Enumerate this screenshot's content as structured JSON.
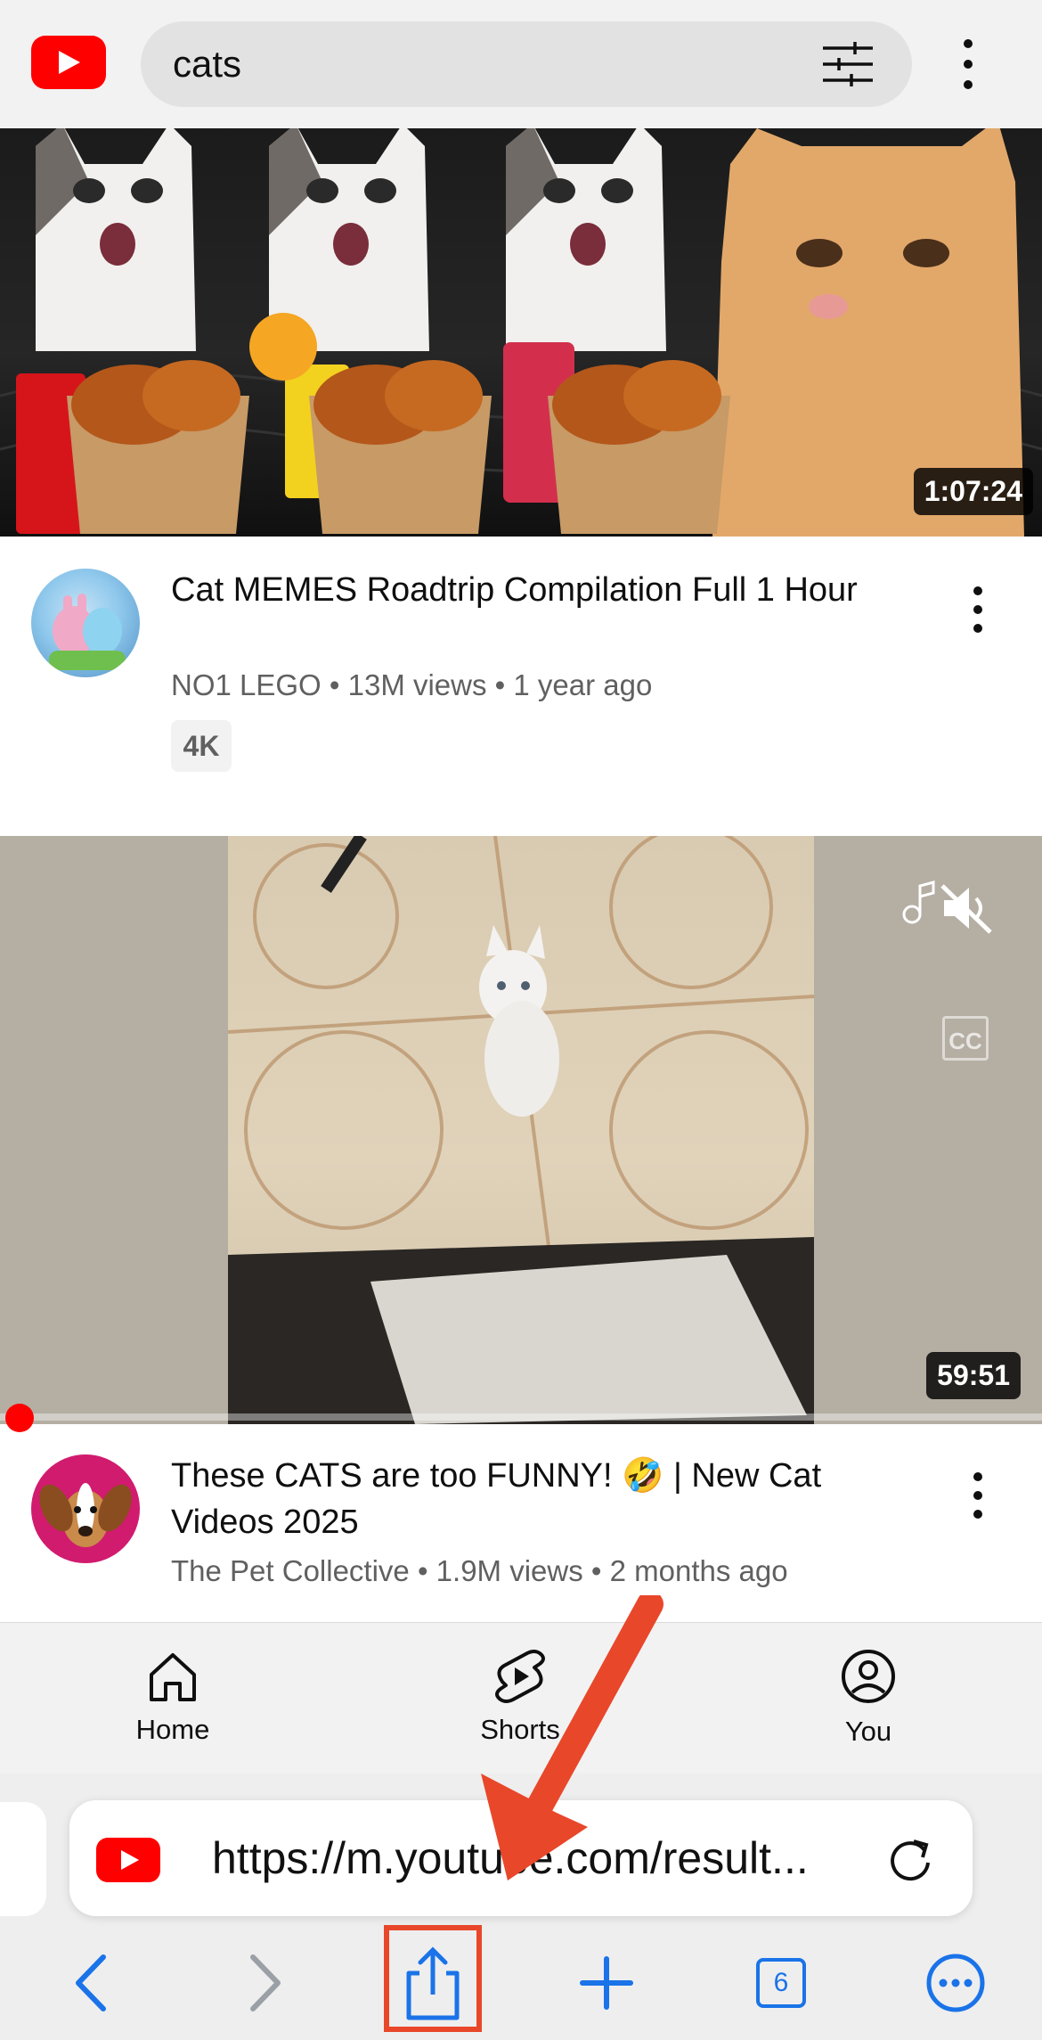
{
  "search": {
    "query": "cats"
  },
  "videos": [
    {
      "title": "Cat MEMES Roadtrip Compilation Full 1 Hour",
      "channel": "NO1 LEGO",
      "meta": "NO1 LEGO • 13M views • 1 year ago",
      "duration": "1:07:24",
      "badge": "4K"
    },
    {
      "title": "These CATS are too FUNNY! 🤣 | New Cat Videos 2025",
      "channel": "The Pet Collective",
      "meta": "The Pet Collective • 1.9M views • 2 months ago",
      "duration": "59:51",
      "captions_label": "CC",
      "playback_progress": 0.01
    }
  ],
  "bottom_nav": [
    {
      "label": "Home",
      "icon": "home-icon"
    },
    {
      "label": "Shorts",
      "icon": "shorts-icon"
    },
    {
      "label": "You",
      "icon": "profile-icon"
    }
  ],
  "browser": {
    "url": "https://m.youtube.com/result...",
    "tab_count": "6",
    "accent_color": "#1a73e8",
    "annotation_color": "#e8472a"
  },
  "colors": {
    "youtube_red": "#ff0000"
  }
}
